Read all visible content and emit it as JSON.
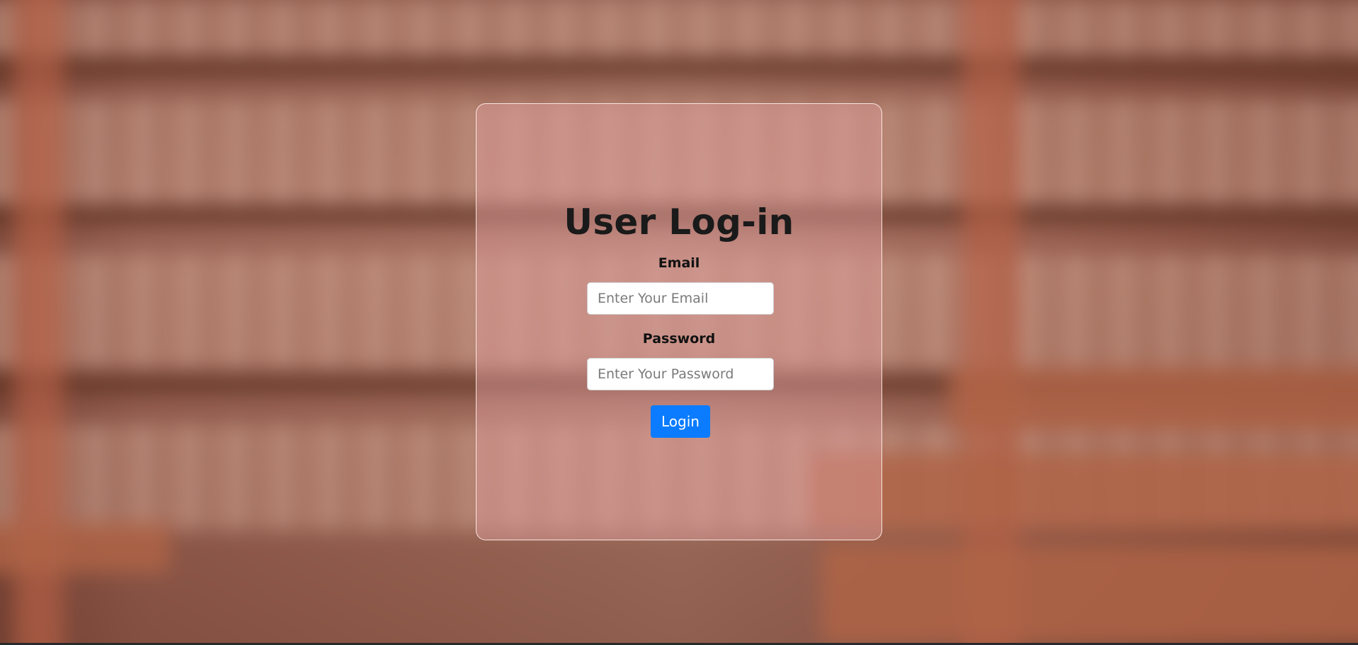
{
  "login": {
    "title": "User Log-in",
    "email_label": "Email",
    "email_placeholder": "Enter Your Email",
    "email_value": "",
    "password_label": "Password",
    "password_placeholder": "Enter Your Password",
    "password_value": "",
    "submit_label": "Login"
  },
  "colors": {
    "accent": "#0b7cff",
    "card_tint": "#e1a0a0",
    "background": "#7a4a3a"
  }
}
